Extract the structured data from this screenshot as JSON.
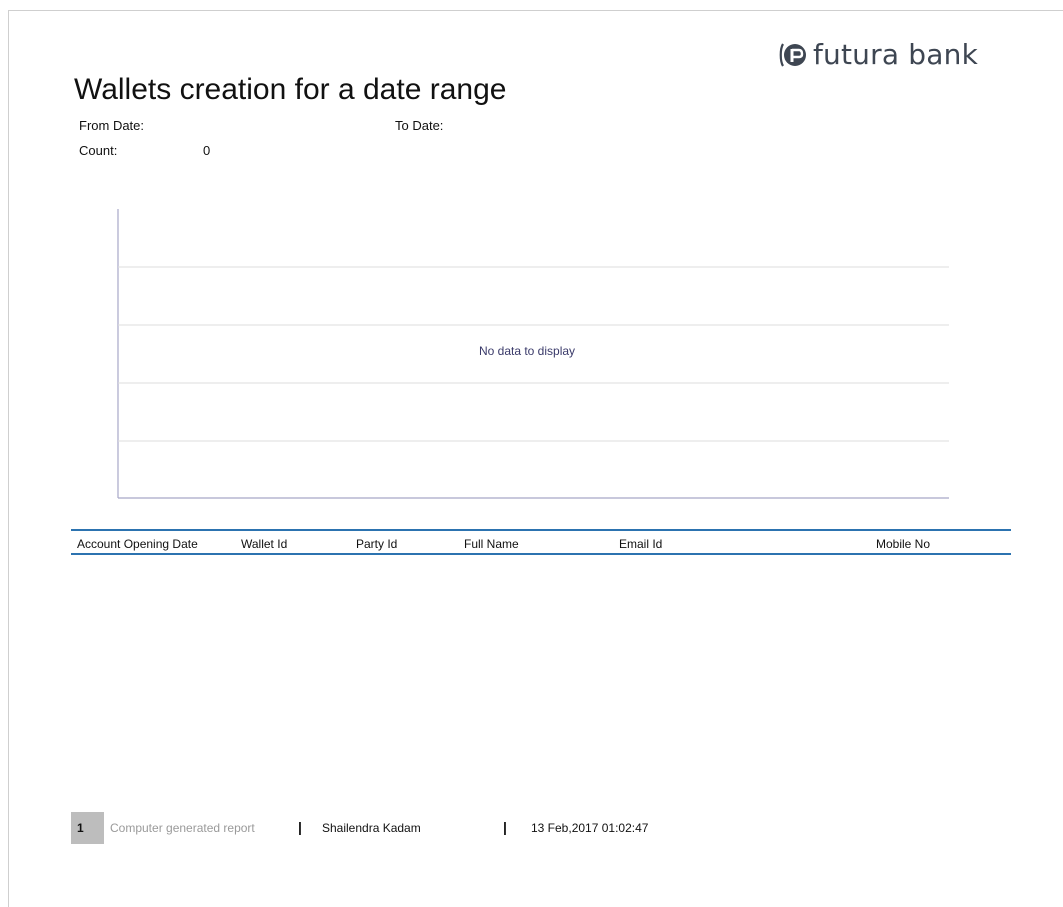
{
  "brand": {
    "logo_icon": "futura-bank-logo-icon",
    "name": "futura bank",
    "color": "#3e4652",
    "accent": "#2c73b0"
  },
  "report": {
    "title": "Wallets creation for a date range",
    "from_date_label": "From Date:",
    "from_date_value": "",
    "to_date_label": "To Date:",
    "to_date_value": "",
    "count_label": "Count:",
    "count_value": "0"
  },
  "chart_data": {
    "type": "bar",
    "categories": [],
    "values": [],
    "title": "",
    "xlabel": "",
    "ylabel": "",
    "grid": true,
    "empty_message": "No data to display"
  },
  "table": {
    "columns": [
      "Account Opening Date",
      "Wallet Id",
      "Party Id",
      "Full Name",
      "Email Id",
      "Mobile No"
    ],
    "rows": []
  },
  "footer": {
    "page_number": "1",
    "note": "Computer generated report",
    "separator": "|",
    "author": "Shailendra Kadam",
    "timestamp": "13 Feb,2017 01:02:47"
  }
}
